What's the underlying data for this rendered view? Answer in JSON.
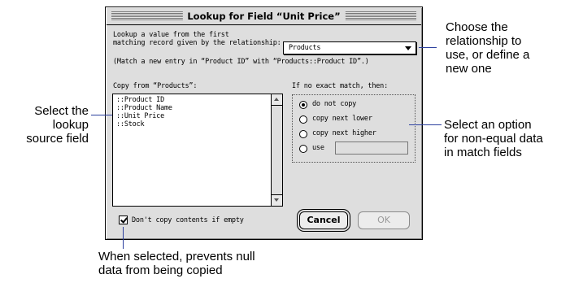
{
  "dialog": {
    "title": "Lookup for Field “Unit Price”",
    "intro_line1": "Lookup a value from the first",
    "intro_line2": "matching record given by the relationship:",
    "relationship_value": "Products",
    "match_note": "(Match a new entry in “Product ID” with “Products::Product ID”.)",
    "copy_from_label": "Copy from “Products”:",
    "fields": [
      "::Product ID",
      "::Product Name",
      "::Unit Price",
      "::Stock"
    ],
    "no_match_label": "If no exact match, then:",
    "options": [
      "do not copy",
      "copy next lower",
      "copy next higher",
      "use"
    ],
    "selected_option": "do not copy",
    "checkbox_label": "Don't copy contents if empty",
    "checkbox_checked": true,
    "cancel_label": "Cancel",
    "ok_label": "OK"
  },
  "callouts": {
    "relationship": [
      "Choose the",
      "relationship to",
      "use, or define a",
      "new one"
    ],
    "source_field": [
      "Select the",
      "lookup",
      "source field"
    ],
    "non_equal": [
      "Select an option",
      "for non-equal data",
      "in match fields"
    ],
    "null_data": [
      "When selected, prevents null",
      "data from being copied"
    ]
  },
  "colors": {
    "leader_line": "#2b3f9e",
    "dialog_bg": "#dedede"
  }
}
